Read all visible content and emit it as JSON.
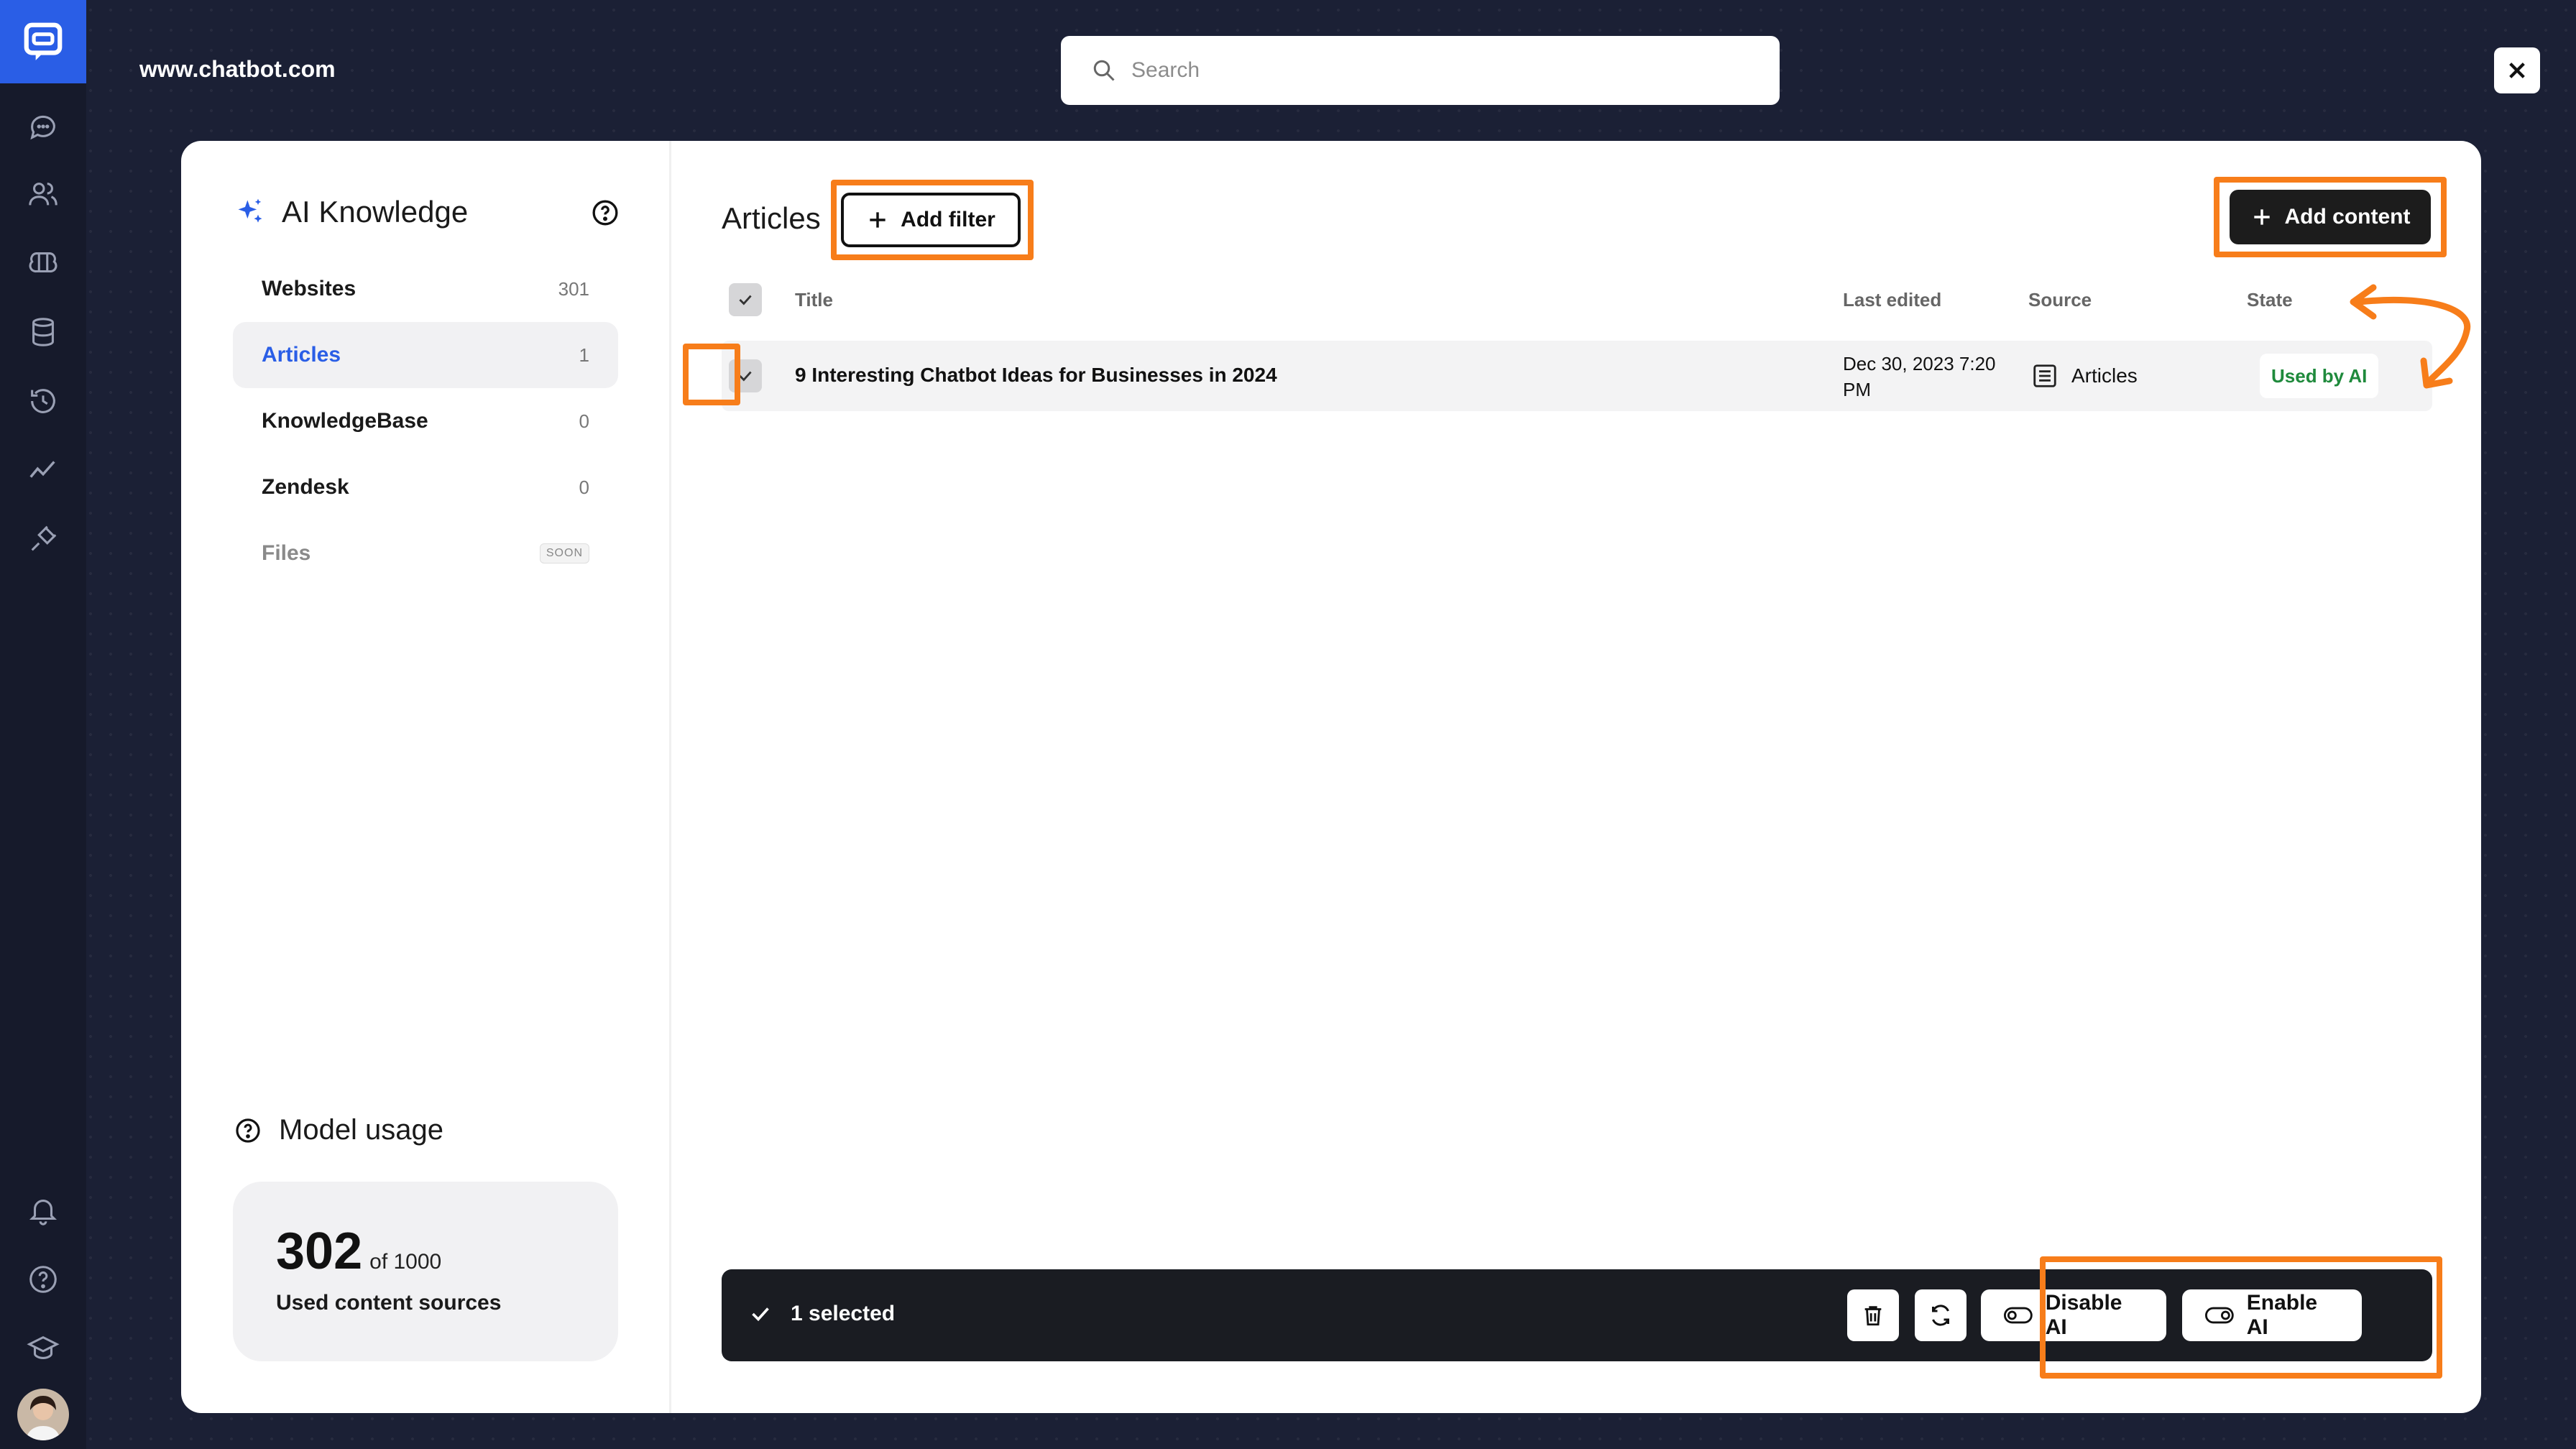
{
  "site": {
    "name": "www.chatbot.com"
  },
  "search": {
    "placeholder": "Search"
  },
  "sidebar": {
    "icons": [
      "chat-bubble-icon",
      "users-icon",
      "brain-icon",
      "database-icon",
      "history-icon",
      "analytics-icon",
      "integrations-icon",
      "bell-icon",
      "help-icon",
      "academy-icon"
    ]
  },
  "knowledge": {
    "title": "AI Knowledge",
    "items": [
      {
        "label": "Websites",
        "count": "301"
      },
      {
        "label": "Articles",
        "count": "1"
      },
      {
        "label": "KnowledgeBase",
        "count": "0"
      },
      {
        "label": "Zendesk",
        "count": "0"
      },
      {
        "label": "Files",
        "badge": "SOON"
      }
    ],
    "active_item": "Articles"
  },
  "model_usage": {
    "title": "Model usage",
    "used": "302",
    "of_total": "of 1000",
    "caption": "Used content sources"
  },
  "main": {
    "title": "Articles",
    "add_filter_label": "Add filter",
    "add_content_label": "Add content",
    "columns": {
      "title": "Title",
      "last_edited": "Last edited",
      "source": "Source",
      "state": "State"
    },
    "rows": [
      {
        "title": "9 Interesting Chatbot Ideas for Businesses in 2024",
        "last_edited_line1": "Dec 30, 2023 7:20",
        "last_edited_line2": "PM",
        "source": "Articles",
        "state": "Used by AI",
        "selected": true
      }
    ]
  },
  "selection_bar": {
    "selected_text": "1 selected",
    "disable_label": "Disable AI",
    "enable_label": "Enable AI"
  },
  "colors": {
    "accent": "#2a5ee6",
    "highlight": "#f77d1a",
    "state_green": "#1f8a3c",
    "background": "#1b2035"
  }
}
